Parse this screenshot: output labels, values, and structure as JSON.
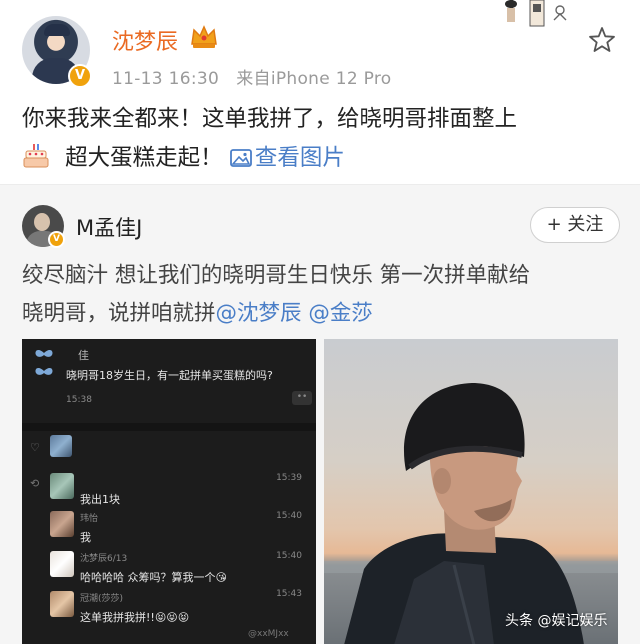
{
  "post": {
    "author": "沈梦辰",
    "verified_badge": "V",
    "timestamp": "11-13 16:30",
    "source": "来自iPhone 12 Pro",
    "text_line1": "你来我来全都来！这单我拼了，给晓明哥排面整上",
    "text_line2": "超大蛋糕走起！",
    "view_pictures": "查看图片",
    "icons": [
      "crown-icon",
      "star-icon",
      "cake-emoji",
      "picture-icon"
    ],
    "colors": {
      "author": "#ea6a23",
      "link": "#4a7ec7",
      "badge": "#f0a20c"
    }
  },
  "repost": {
    "author": "M孟佳J",
    "follow_label": "+ 关注",
    "text_line1": "绞尽脑汁 想让我们的晓明哥生日快乐 第一次拼单献给",
    "text_line2_prefix": "晓明哥，说拼咱就拼",
    "mention1": "@沈梦辰",
    "mention2": "@金莎"
  },
  "chat": {
    "top_name": "佳",
    "top_message": "晓明哥18岁生日，有一起拼单买蛋糕的吗?",
    "top_time": "15:38",
    "messages": [
      {
        "name": "",
        "text": "我出1块",
        "time": "15:39"
      },
      {
        "name": "玮怡",
        "text": "我",
        "time": "15:40"
      },
      {
        "name": "沈梦辰6/13",
        "text": "哈哈哈哈 众筹吗？算我一个😘",
        "time": "15:40"
      },
      {
        "name": "冠潮(莎莎)",
        "text": "这单我拼我拼!!😝😝😝",
        "time": "15:43"
      }
    ],
    "watermark": "@xxMJxx"
  },
  "footer": {
    "watermark": "头条 @娱记娱乐"
  }
}
